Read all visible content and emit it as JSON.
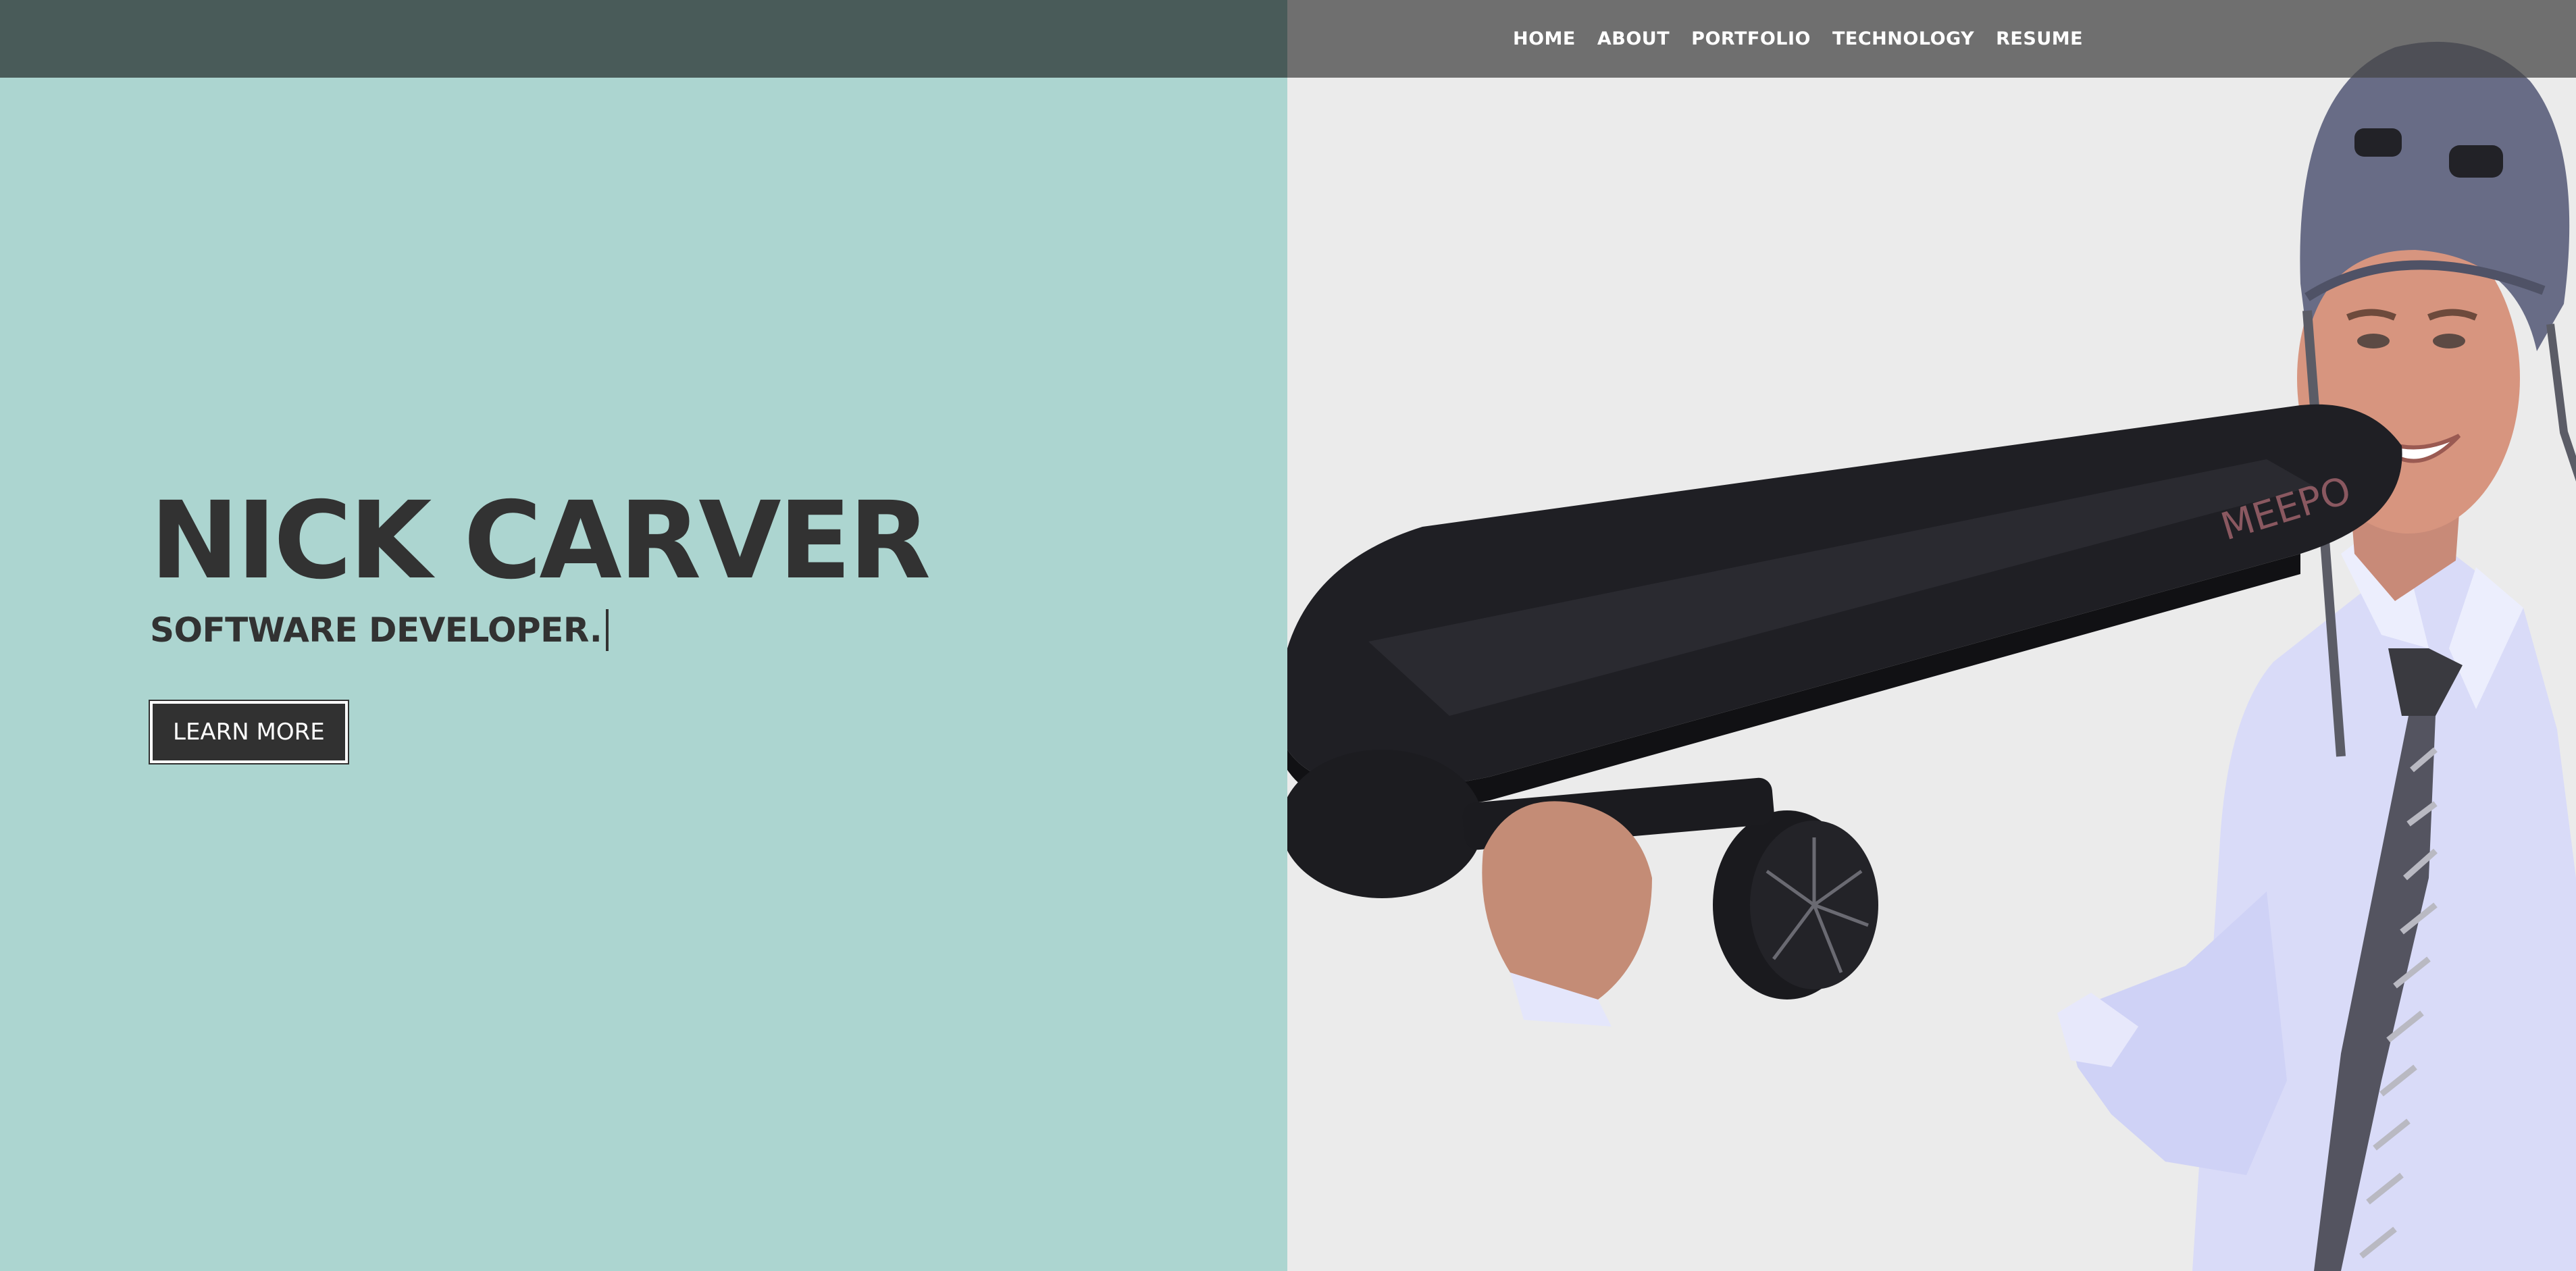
{
  "nav": {
    "items": [
      {
        "label": "HOME"
      },
      {
        "label": "ABOUT"
      },
      {
        "label": "PORTFOLIO"
      },
      {
        "label": "TECHNOLOGY"
      },
      {
        "label": "RESUME"
      }
    ]
  },
  "hero": {
    "name": "NICK CARVER",
    "subtitle": "SOFTWARE DEVELOPER.",
    "button_label": "LEARN MORE"
  },
  "colors": {
    "left_panel": "#acd5d0",
    "right_panel": "#ebebeb",
    "text_dark": "#323232",
    "button_bg": "#313131",
    "nav_text": "#ffffff"
  },
  "photo": {
    "board_brand": "MEEPO"
  }
}
